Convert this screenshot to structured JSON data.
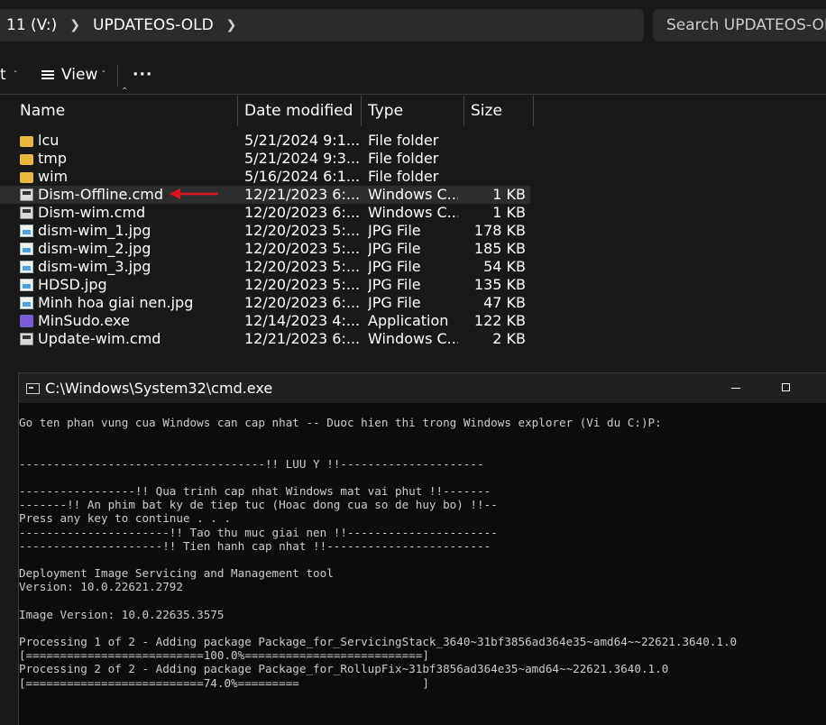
{
  "explorer": {
    "breadcrumb": [
      "11 (V:)",
      "UPDATEOS-OLD"
    ],
    "search_placeholder": "Search UPDATEOS-OLD",
    "toolbar": {
      "partial_label": "t",
      "view_label": "View",
      "more_label": "···"
    },
    "columns": {
      "name": "Name",
      "date": "Date modified",
      "type": "Type",
      "size": "Size"
    },
    "files": [
      {
        "name": "lcu",
        "date": "5/21/2024 9:1...",
        "type": "File folder",
        "size": "",
        "icon": "folder-icon"
      },
      {
        "name": "tmp",
        "date": "5/21/2024 9:3...",
        "type": "File folder",
        "size": "",
        "icon": "folder-icon"
      },
      {
        "name": "wim",
        "date": "5/16/2024 6:1...",
        "type": "File folder",
        "size": "",
        "icon": "folder-icon"
      },
      {
        "name": "Dism-Offline.cmd",
        "date": "12/21/2023 6:...",
        "type": "Windows C...",
        "size": "1 KB",
        "icon": "cmd-file-icon",
        "selected": true
      },
      {
        "name": "Dism-wim.cmd",
        "date": "12/20/2023 6:...",
        "type": "Windows C...",
        "size": "1 KB",
        "icon": "cmd-file-icon"
      },
      {
        "name": "dism-wim_1.jpg",
        "date": "12/20/2023 5:...",
        "type": "JPG File",
        "size": "178 KB",
        "icon": "image-file-icon"
      },
      {
        "name": "dism-wim_2.jpg",
        "date": "12/20/2023 5:...",
        "type": "JPG File",
        "size": "185 KB",
        "icon": "image-file-icon"
      },
      {
        "name": "dism-wim_3.jpg",
        "date": "12/20/2023 5:...",
        "type": "JPG File",
        "size": "54 KB",
        "icon": "image-file-icon"
      },
      {
        "name": "HDSD.jpg",
        "date": "12/20/2023 5:...",
        "type": "JPG File",
        "size": "135 KB",
        "icon": "image-file-icon"
      },
      {
        "name": "Minh hoa giai nen.jpg",
        "date": "12/20/2023 6:...",
        "type": "JPG File",
        "size": "47 KB",
        "icon": "image-file-icon"
      },
      {
        "name": "MinSudo.exe",
        "date": "12/14/2023 4:...",
        "type": "Application",
        "size": "122 KB",
        "icon": "exe-file-icon"
      },
      {
        "name": "Update-wim.cmd",
        "date": "12/21/2023 6:...",
        "type": "Windows C...",
        "size": "2 KB",
        "icon": "cmd-file-icon"
      }
    ]
  },
  "cmd": {
    "title": "C:\\Windows\\System32\\cmd.exe",
    "lines": [
      "Go ten phan vung cua Windows can cap nhat -- Duoc hien thi trong Windows explorer (Vi du C:)P:",
      "",
      "",
      "------------------------------------!! LUU Y !!---------------------",
      "",
      "-----------------!! Qua trinh cap nhat Windows mat vai phut !!-------",
      "-------!! An phim bat ky de tiep tuc (Hoac dong cua so de huy bo) !!--",
      "Press any key to continue . . .",
      "----------------------!! Tao thu muc giai nen !!----------------------",
      "---------------------!! Tien hanh cap nhat !!------------------------",
      "",
      "Deployment Image Servicing and Management tool",
      "Version: 10.0.22621.2792",
      "",
      "Image Version: 10.0.22635.3575",
      "",
      "Processing 1 of 2 - Adding package Package_for_ServicingStack_3640~31bf3856ad364e35~amd64~~22621.3640.1.0",
      "[==========================100.0%==========================]",
      "Processing 2 of 2 - Adding package Package_for_RollupFix~31bf3856ad364e35~amd64~~22621.3640.1.0",
      "[==========================74.0%=========                  ]"
    ]
  },
  "colors": {
    "annotation_arrow": "#e0141e",
    "folder": "#e8b73b"
  }
}
